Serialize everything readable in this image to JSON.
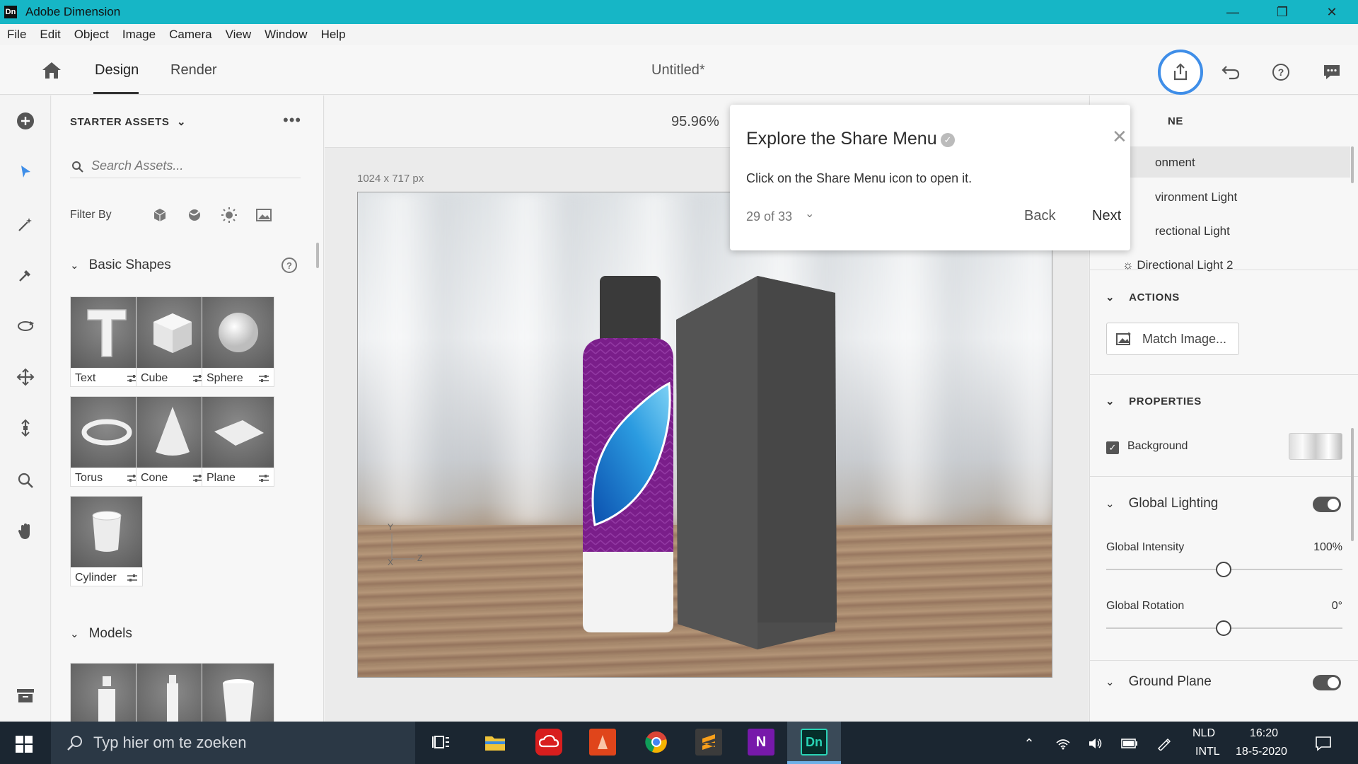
{
  "window": {
    "title": "Adobe Dimension",
    "logo_text": "Dn",
    "minimize": "—",
    "restore": "❐",
    "close": "✕"
  },
  "menu": [
    "File",
    "Edit",
    "Object",
    "Image",
    "Camera",
    "View",
    "Window",
    "Help"
  ],
  "header": {
    "tabs": [
      "Design",
      "Render"
    ],
    "active_tab": "Design",
    "doc_title": "Untitled*"
  },
  "assets_panel": {
    "title": "STARTER ASSETS",
    "more": "•••",
    "search_placeholder": "Search Assets...",
    "filter_label": "Filter By",
    "sections": {
      "basic_shapes": "Basic Shapes",
      "models": "Models"
    },
    "shapes": [
      {
        "label": "Text"
      },
      {
        "label": "Cube"
      },
      {
        "label": "Sphere"
      },
      {
        "label": "Torus"
      },
      {
        "label": "Cone"
      },
      {
        "label": "Plane"
      },
      {
        "label": "Cylinder"
      }
    ]
  },
  "canvas": {
    "zoom": "95.96%",
    "size_label": "1024 x 717 px",
    "axis_y": "Y",
    "axis_z": "Z",
    "axis_x": "X"
  },
  "tutorial_popover": {
    "title": "Explore the Share Menu",
    "body": "Click on the Share Menu icon to open it.",
    "progress": "29 of 33",
    "back_label": "Back",
    "next_label": "Next",
    "close": "✕"
  },
  "right_panel": {
    "scene_header": "NE",
    "scene_items": [
      "onment",
      "vironment Light",
      "rectional Light",
      "Directional Light 2"
    ],
    "actions_header": "ACTIONS",
    "match_image_label": "Match Image...",
    "properties_header": "PROPERTIES",
    "background_label": "Background",
    "background_checked": true,
    "global_lighting": {
      "label": "Global Lighting",
      "enabled": true,
      "intensity_label": "Global Intensity",
      "intensity_value": "100%",
      "rotation_label": "Global Rotation",
      "rotation_value": "0°"
    },
    "ground_plane": {
      "label": "Ground Plane",
      "enabled": true
    }
  },
  "taskbar": {
    "search_placeholder": "Typ hier om te zoeken",
    "language": "NLD",
    "keyboard": "INTL",
    "time": "16:20",
    "date": "18-5-2020",
    "active_app_label": "Dn"
  },
  "colors": {
    "titlebar": "#16b6c6",
    "accent": "#3f8ee8",
    "taskbar": "#1b2631"
  }
}
